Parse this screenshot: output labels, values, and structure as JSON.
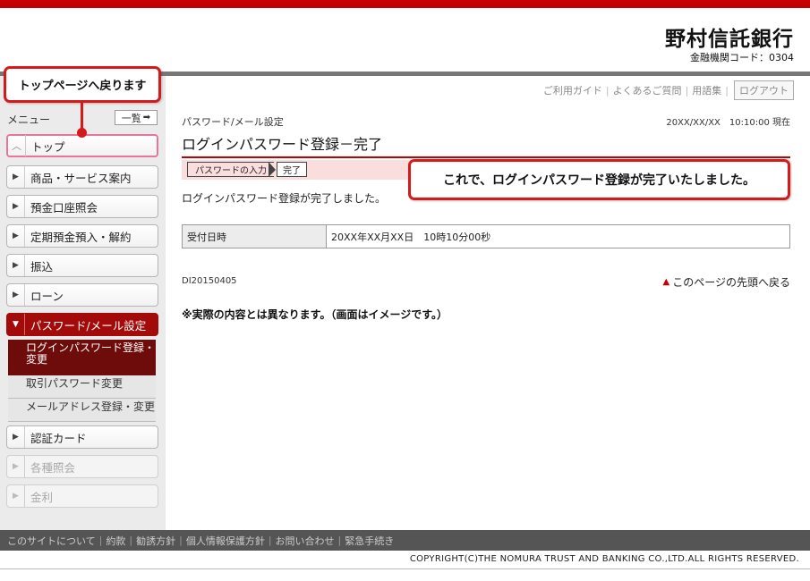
{
  "header": {
    "bank_name": "野村信託銀行",
    "bank_code": "金融機関コード：0304"
  },
  "utility_nav": {
    "links": [
      "ご利用ガイド",
      "よくあるご質問",
      "用語集"
    ],
    "logout_label": "ログアウト"
  },
  "sidebar": {
    "menu_label": "メニュー",
    "list_button_label": "一覧",
    "callout": "トップページへ戻ります",
    "items": [
      {
        "label": "トップ"
      },
      {
        "label": "商品・サービス案内"
      },
      {
        "label": "預金口座照会"
      },
      {
        "label": "定期預金預入・解約"
      },
      {
        "label": "振込"
      },
      {
        "label": "ローン"
      },
      {
        "label": "パスワード/メール設定"
      },
      {
        "label": "認証カード"
      },
      {
        "label": "各種照会"
      },
      {
        "label": "金利"
      }
    ],
    "sub_items": [
      {
        "label": "ログインパスワード登録・変更"
      },
      {
        "label": "取引パスワード変更"
      },
      {
        "label": "メールアドレス登録・変更"
      }
    ]
  },
  "main": {
    "breadcrumb": "パスワード/メール設定",
    "datetime": "20XX/XX/XX　10:10:00 現在",
    "title": "ログインパスワード登録－完了",
    "steps": [
      "パスワードの入力",
      "完了"
    ],
    "complete_message": "ログインパスワード登録が完了しました。",
    "callout": "これで、ログインパスワード登録が完了いたしました。",
    "table": {
      "header": "受付日時",
      "value": "20XX年XX月XX日　10時10分00秒"
    },
    "screen_id": "DI20150405",
    "to_top_label": "このページの先頭へ戻る",
    "note": "※実際の内容とは異なります。（画面はイメージです。）"
  },
  "footer": {
    "links": [
      "このサイトについて",
      "約款",
      "勧誘方針",
      "個人情報保護方針",
      "お問い合わせ",
      "緊急手続き"
    ],
    "copyright": "COPYRIGHT(C)THE NOMURA TRUST AND BANKING CO.,LTD.ALL RIGHTS RESERVED."
  },
  "colors": {
    "brand_red": "#c40000",
    "active_nav": "#a30b0b",
    "active_sub": "#6e0c0c",
    "callout_border": "#d61a1a"
  }
}
